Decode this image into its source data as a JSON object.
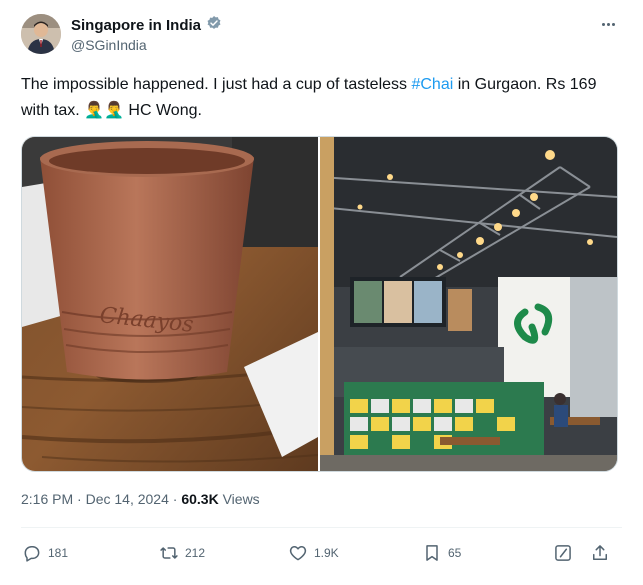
{
  "tweet": {
    "author_name": "Singapore in India",
    "author_handle": "@SGinIndia",
    "text_part1": "The impossible happened. I just had a cup of tasteless ",
    "hashtag": "#Chai",
    "text_part2": " in Gurgaon. Rs 169 with tax. ",
    "emojis": "🤦‍♂️🤦‍♂️",
    "text_part3": " HC Wong.",
    "cup_brand": "Chaayos",
    "time": "2:16 PM",
    "separator": "·",
    "date": "Dec 14, 2024",
    "separator2": "·",
    "views_count": "60.3K",
    "views_label": "Views"
  },
  "actions": {
    "replies": "181",
    "reposts": "212",
    "likes": "1.9K",
    "bookmarks": "65"
  },
  "colors": {
    "accent": "#1d9bf0",
    "text_primary": "#0f1419",
    "text_secondary": "#536471",
    "store_green": "#1e8a4a"
  },
  "icons": [
    "verified-badge-icon",
    "more-icon",
    "reply-icon",
    "repost-icon",
    "like-icon",
    "bookmark-icon",
    "grok-icon",
    "share-icon"
  ]
}
